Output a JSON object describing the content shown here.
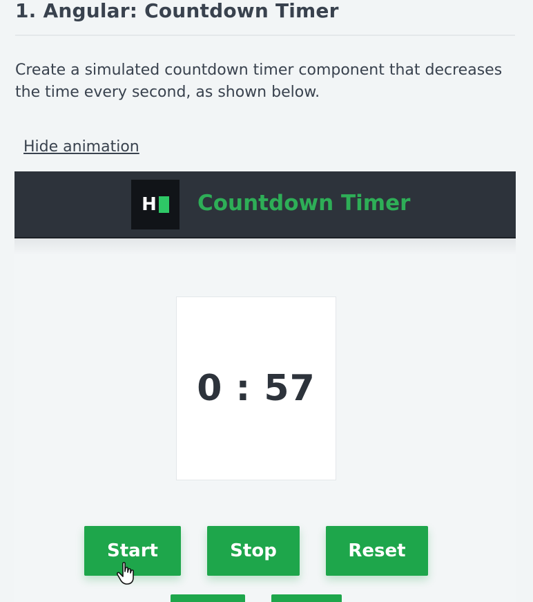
{
  "problem": {
    "title": "1. Angular: Countdown Timer",
    "description": "Create a simulated countdown timer component that decreases the time every second, as shown below.",
    "toggle_label": "Hide animation"
  },
  "demo": {
    "logo_letter": "H",
    "app_title": "Countdown Timer",
    "timer_value": "0 : 57",
    "buttons": {
      "start": "Start",
      "stop": "Stop",
      "reset": "Reset"
    }
  },
  "colors": {
    "brand_green": "#1ea64b",
    "title_green": "#2eae57",
    "header_dark": "#2d333b",
    "text": "#39424e"
  },
  "icons": {
    "cursor": "hand-pointer-icon",
    "logo": "hackerrank-logo-icon"
  }
}
